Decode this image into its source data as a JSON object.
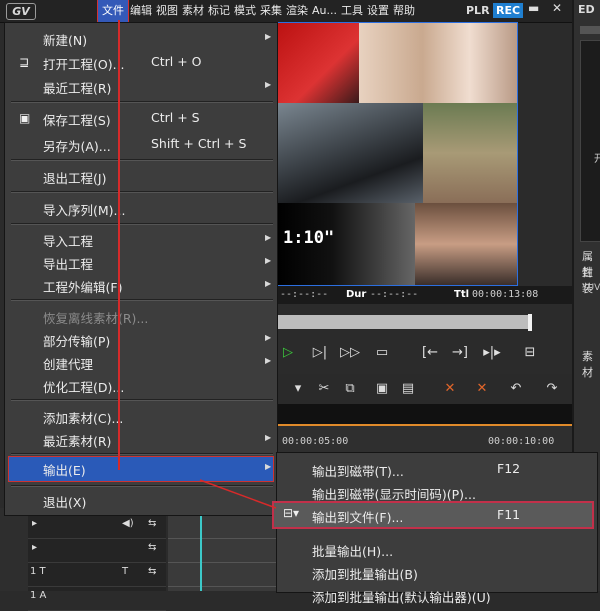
{
  "app": {
    "logo": "GV",
    "menus": [
      "文件",
      "编辑",
      "视图",
      "素材",
      "标记",
      "模式",
      "采集",
      "渲染",
      "Au...",
      "工具",
      "设置",
      "帮助"
    ],
    "plr": "PLR",
    "rec": "REC",
    "min": "▬",
    "close": "✕"
  },
  "right_panel": {
    "title": "ED",
    "prop1": "属性",
    "prop2": "封装",
    "prop3": "YUV",
    "prop4": "素材",
    "char": "开"
  },
  "preview": {
    "overlay_timecode": "1:10\""
  },
  "timebar": {
    "in": "--:--:--",
    "dur_label": "Dur",
    "dur": "--:--:--",
    "ttl_label": "Ttl",
    "ttl": "00:00:13:08"
  },
  "ruler": {
    "t1": "00:00:05:00",
    "t2": "00:00:10:00"
  },
  "tracks": {
    "t1_label": "1 T",
    "t2_label": "1 A"
  },
  "file_menu": [
    {
      "label": "新建(N)",
      "shortcut": "",
      "submenu": true,
      "icon": ""
    },
    {
      "label": "打开工程(O)...",
      "shortcut": "Ctrl + O",
      "submenu": false,
      "icon": "open-folder"
    },
    {
      "label": "最近工程(R)",
      "shortcut": "",
      "submenu": true,
      "icon": ""
    },
    {
      "label": "保存工程(S)",
      "shortcut": "Ctrl + S",
      "submenu": false,
      "icon": "floppy"
    },
    {
      "label": "另存为(A)...",
      "shortcut": "Shift + Ctrl + S",
      "submenu": false,
      "icon": ""
    },
    {
      "label": "退出工程(J)",
      "shortcut": "",
      "submenu": false,
      "icon": ""
    },
    {
      "label": "导入序列(M)...",
      "shortcut": "",
      "submenu": false,
      "icon": ""
    },
    {
      "label": "导入工程",
      "shortcut": "",
      "submenu": true,
      "icon": ""
    },
    {
      "label": "导出工程",
      "shortcut": "",
      "submenu": true,
      "icon": ""
    },
    {
      "label": "工程外编辑(F)",
      "shortcut": "",
      "submenu": true,
      "icon": ""
    },
    {
      "label": "恢复离线素材(R)...",
      "shortcut": "",
      "submenu": false,
      "icon": "",
      "disabled": true
    },
    {
      "label": "部分传输(P)",
      "shortcut": "",
      "submenu": true,
      "icon": ""
    },
    {
      "label": "创建代理",
      "shortcut": "",
      "submenu": true,
      "icon": ""
    },
    {
      "label": "优化工程(D)...",
      "shortcut": "",
      "submenu": false,
      "icon": ""
    },
    {
      "label": "添加素材(C)...",
      "shortcut": "",
      "submenu": false,
      "icon": ""
    },
    {
      "label": "最近素材(R)",
      "shortcut": "",
      "submenu": true,
      "icon": ""
    },
    {
      "label": "输出(E)",
      "shortcut": "",
      "submenu": true,
      "icon": "",
      "selected": true
    },
    {
      "label": "退出(X)",
      "shortcut": "",
      "submenu": false,
      "icon": ""
    }
  ],
  "export_menu": [
    {
      "label": "输出到磁带(T)...",
      "shortcut": "F12"
    },
    {
      "label": "输出到磁带(显示时间码)(P)...",
      "shortcut": ""
    },
    {
      "label": "输出到文件(F)...",
      "shortcut": "F11",
      "selected": true
    },
    {
      "label": "批量输出(H)...",
      "shortcut": ""
    },
    {
      "label": "添加到批量输出(B)",
      "shortcut": ""
    },
    {
      "label": "添加到批量输出(默认输出器)(U)",
      "shortcut": ""
    }
  ],
  "colors": {
    "accent": "#2a5ab8",
    "annotation": "#d62a2a",
    "menu_bg": "#3d3d3d"
  }
}
